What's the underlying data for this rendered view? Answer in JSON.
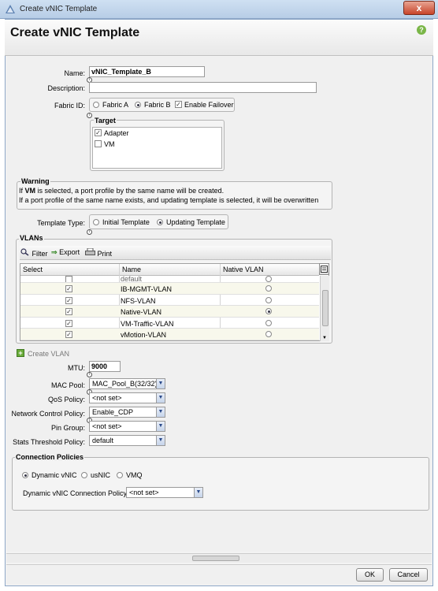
{
  "window": {
    "title": "Create vNIC Template",
    "close_label": "x"
  },
  "header": {
    "title": "Create vNIC Template",
    "help_label": "?"
  },
  "form": {
    "name_label": "Name:",
    "name_value": "vNIC_Template_B",
    "description_label": "Description:",
    "description_value": "",
    "fabric_label": "Fabric ID:",
    "fabric_a": "Fabric A",
    "fabric_b": "Fabric B",
    "fabric_selected": "Fabric B",
    "enable_failover": "Enable Failover",
    "enable_failover_checked": true,
    "target_title": "Target",
    "target_adapter": "Adapter",
    "target_adapter_checked": true,
    "target_vm": "VM",
    "target_vm_checked": false,
    "template_type_label": "Template Type:",
    "initial_template": "Initial Template",
    "updating_template": "Updating Template",
    "template_type_selected": "Updating Template"
  },
  "warning": {
    "title": "Warning",
    "line1_prefix": "If ",
    "line1_bold": "VM",
    "line1_suffix": " is selected, a port profile by the same name will be created.",
    "line2": "If a port profile of the same name exists, and updating template is selected, it will be overwritten"
  },
  "vlans": {
    "title": "VLANs",
    "toolbar": {
      "filter": "Filter",
      "export": "Export",
      "print": "Print"
    },
    "columns": [
      "Select",
      "Name",
      "Native VLAN"
    ],
    "rows": [
      {
        "name": "default",
        "selected": false,
        "native": false
      },
      {
        "name": "IB-MGMT-VLAN",
        "selected": true,
        "native": false
      },
      {
        "name": "NFS-VLAN",
        "selected": true,
        "native": false
      },
      {
        "name": "Native-VLAN",
        "selected": true,
        "native": true
      },
      {
        "name": "VM-Traffic-VLAN",
        "selected": true,
        "native": false
      },
      {
        "name": "vMotion-VLAN",
        "selected": true,
        "native": false
      }
    ],
    "create_vlan": "Create VLAN"
  },
  "settings": {
    "mtu_label": "MTU:",
    "mtu_value": "9000",
    "mac_pool_label": "MAC Pool:",
    "mac_pool_value": "MAC_Pool_B(32/32)",
    "qos_label": "QoS Policy:",
    "qos_value": "<not set>",
    "ncp_label": "Network Control Policy:",
    "ncp_value": "Enable_CDP",
    "pin_label": "Pin Group:",
    "pin_value": "<not set>",
    "stats_label": "Stats Threshold Policy:",
    "stats_value": "default"
  },
  "connection": {
    "title": "Connection Policies",
    "dynamic_vnic": "Dynamic vNIC",
    "usnic": "usNIC",
    "vmq": "VMQ",
    "selected": "Dynamic vNIC",
    "policy_label": "Dynamic vNIC Connection Policy:",
    "policy_value": "<not set>"
  },
  "footer": {
    "ok": "OK",
    "cancel": "Cancel"
  },
  "colors": {
    "title_bar": "#c4d7ee",
    "accent": "#2a4a8a",
    "help": "#7ab648",
    "close": "#c8442a"
  }
}
